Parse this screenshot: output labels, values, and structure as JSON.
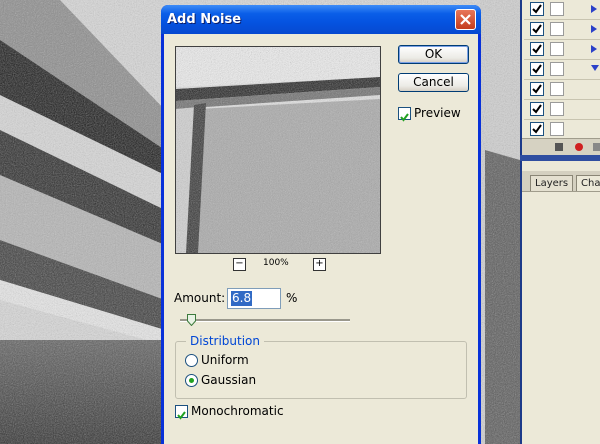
{
  "dialog": {
    "title": "Add Noise",
    "ok_label": "OK",
    "cancel_label": "Cancel",
    "preview": {
      "label": "Preview",
      "checked": true
    },
    "zoom": {
      "level": "100%",
      "minus_label": "−",
      "plus_label": "+"
    },
    "amount": {
      "label": "Amount:",
      "value": "6.8",
      "unit": "%",
      "slider_fraction": 0.068
    },
    "distribution": {
      "legend": "Distribution",
      "options": [
        {
          "label": "Uniform",
          "selected": false
        },
        {
          "label": "Gaussian",
          "selected": true
        }
      ]
    },
    "monochromatic": {
      "label": "Monochromatic",
      "checked": true
    }
  },
  "channels_panel": {
    "tabs": [
      "Layers",
      "Chan"
    ]
  },
  "colors": {
    "titlebar": "#0553e0",
    "accent_selection": "#316ac5",
    "panel_bg": "#ece9d8"
  },
  "icons": [
    "close-icon",
    "zoom-out-icon",
    "zoom-in-icon",
    "checkmark-icon",
    "expand-triangle-icon",
    "slider-thumb-icon"
  ]
}
